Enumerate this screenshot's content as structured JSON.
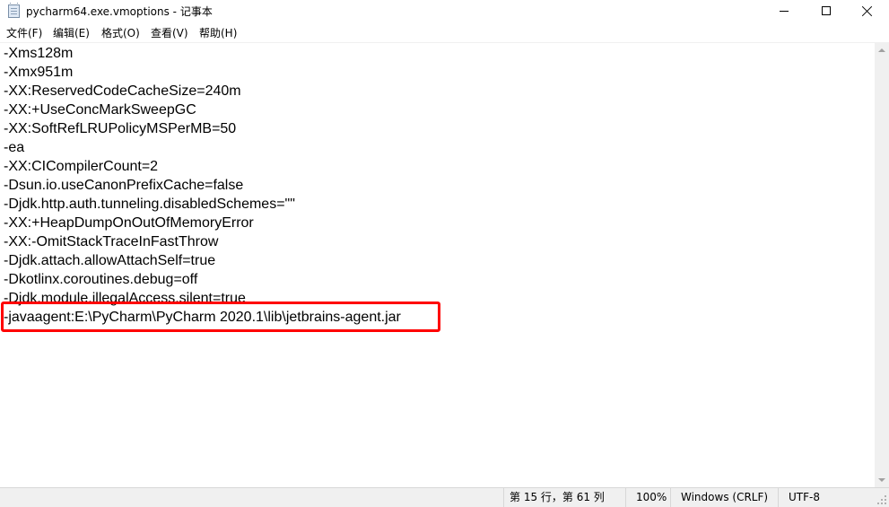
{
  "window": {
    "title": "pycharm64.exe.vmoptions - 记事本"
  },
  "menu": [
    {
      "label": "文件(F)"
    },
    {
      "label": "编辑(E)"
    },
    {
      "label": "格式(O)"
    },
    {
      "label": "查看(V)"
    },
    {
      "label": "帮助(H)"
    }
  ],
  "editor": {
    "lines": [
      "-Xms128m",
      "-Xmx951m",
      "-XX:ReservedCodeCacheSize=240m",
      "-XX:+UseConcMarkSweepGC",
      "-XX:SoftRefLRUPolicyMSPerMB=50",
      "-ea",
      "-XX:CICompilerCount=2",
      "-Dsun.io.useCanonPrefixCache=false",
      "-Djdk.http.auth.tunneling.disabledSchemes=\"\"",
      "-XX:+HeapDumpOnOutOfMemoryError",
      "-XX:-OmitStackTraceInFastThrow",
      "-Djdk.attach.allowAttachSelf=true",
      "-Dkotlinx.coroutines.debug=off",
      "-Djdk.module.illegalAccess.silent=true",
      "-javaagent:E:\\PyCharm\\PyCharm 2020.1\\lib\\jetbrains-agent.jar"
    ],
    "highlight_color": "#ff0000"
  },
  "status": {
    "position": "第 15 行，第 61 列",
    "zoom": "100%",
    "line_ending": "Windows (CRLF)",
    "encoding": "UTF-8"
  }
}
